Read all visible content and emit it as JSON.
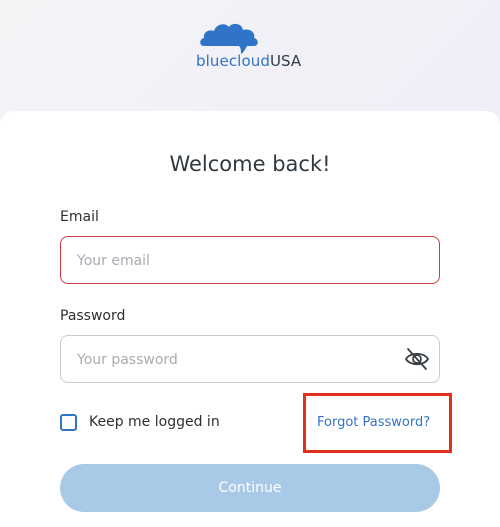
{
  "brand": {
    "name_part1": "bluecloud",
    "name_part2": "USA",
    "color_blue": "#2f74c6",
    "color_dark": "#2d3b4a",
    "logo_icon": "cloud-icon"
  },
  "login": {
    "title": "Welcome back!",
    "email_label": "Email",
    "email_placeholder": "Your email",
    "email_value": "",
    "password_label": "Password",
    "password_placeholder": "Your password",
    "password_value": "",
    "password_toggle_icon": "eye-off-icon",
    "keep_logged_in_label": "Keep me logged in",
    "keep_logged_in_checked": false,
    "forgot_password_label": "Forgot Password?",
    "continue_label": "Continue",
    "continue_enabled": false
  },
  "colors": {
    "error_border": "#d23b3b",
    "highlight_border": "#e1311b",
    "button_disabled": "#a9cae7",
    "link": "#2f74c6"
  }
}
